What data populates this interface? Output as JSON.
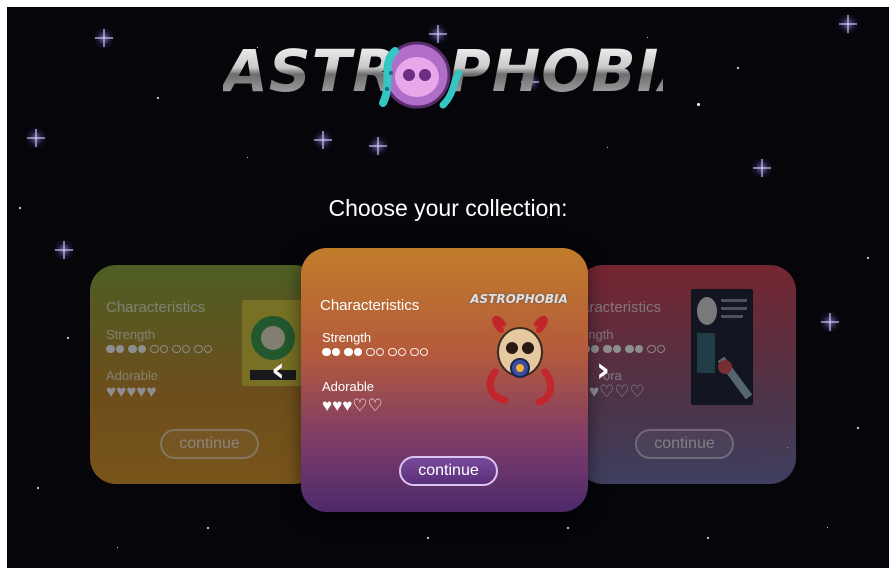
{
  "logo": {
    "text": "ASTROPHOBIA"
  },
  "heading": "Choose your collection:",
  "cards": {
    "left": {
      "title": "Characteristics",
      "strength_label": "Strength",
      "strength_level": 2,
      "adorable_label": "Adorable",
      "adorable_hearts": "♥♥♥♥♥",
      "button": "continue"
    },
    "center": {
      "title": "Characteristics",
      "strength_label": "Strength",
      "strength_level": 2,
      "adorable_label": "Adorable",
      "adorable_hearts": "♥♥♥♡♡",
      "button": "continue",
      "badge_text": "ASTROPHOBIA"
    },
    "right": {
      "title": "aracteristics",
      "strength_label": "ength",
      "strength_level": 3,
      "adorable_label": "ora",
      "adorable_hearts": "♥♡♡♡",
      "button": "continue"
    }
  },
  "nav": {
    "prev": "‹",
    "next": "›"
  },
  "colors": {
    "background": "#05050a",
    "button_border": "#d9c6f0",
    "accent": "#5a2e7a"
  }
}
